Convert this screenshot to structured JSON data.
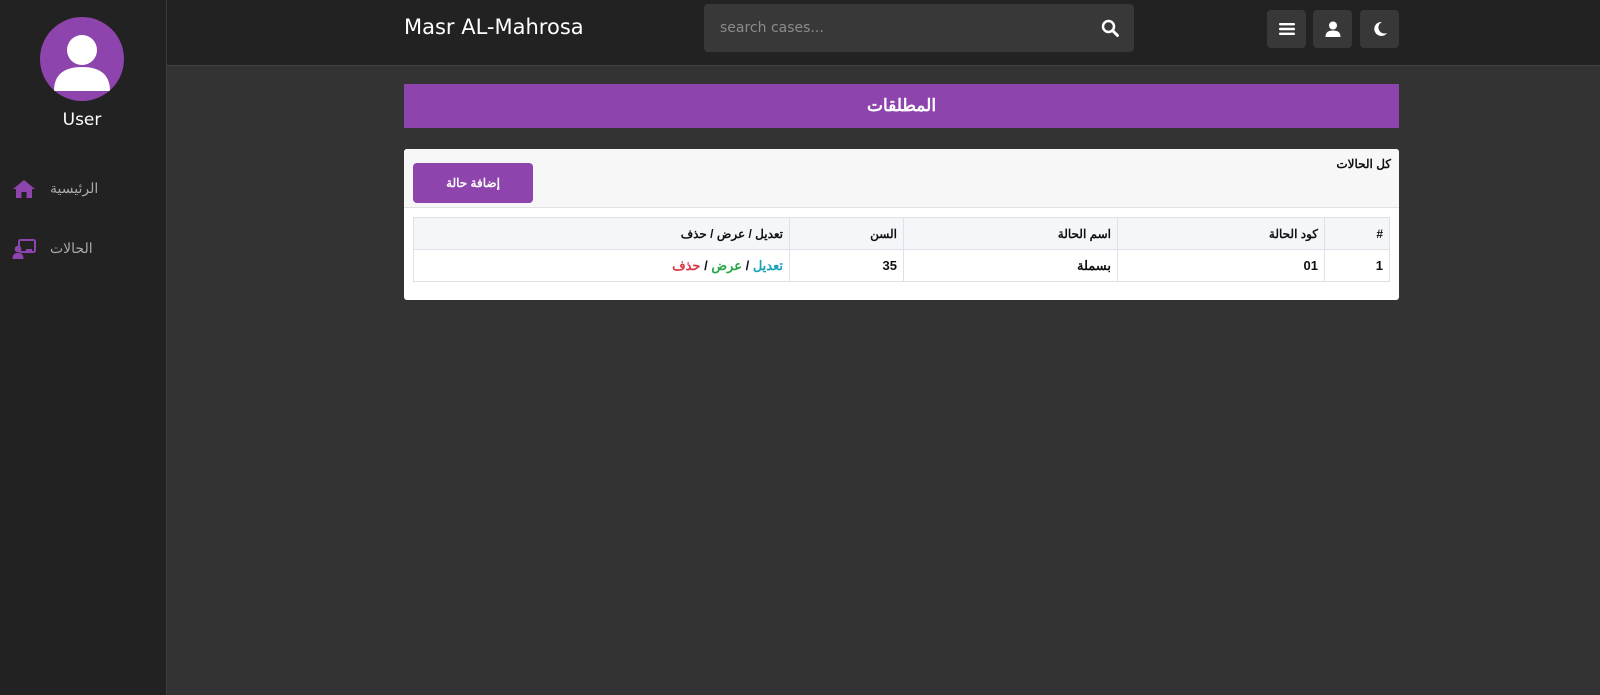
{
  "sidebar": {
    "user_name": "User",
    "items": [
      {
        "label": "الرئيسية",
        "icon": "home-icon"
      },
      {
        "label": "الحالات",
        "icon": "chalkboard-user-icon"
      }
    ]
  },
  "header": {
    "brand": "Masr AL-Mahrosa",
    "search_placeholder": "search cases...",
    "buttons": [
      "menu-icon",
      "user-icon",
      "moon-icon"
    ]
  },
  "page": {
    "title": "المطلقات"
  },
  "card": {
    "title": "كل الحالات",
    "add_button": "إضافة حالة"
  },
  "table": {
    "columns": [
      "#",
      "كود الحالة",
      "اسم الحالة",
      "السن",
      "تعديل / عرض / حذف"
    ],
    "rows": [
      {
        "num": "1",
        "code": "01",
        "name": "بسملة",
        "age": "35",
        "edit": "تعديل",
        "view": "عرض",
        "delete": "حذف"
      }
    ],
    "separator": " / "
  },
  "colors": {
    "accent": "#8e44ad",
    "background": "#333333",
    "sidebar": "#222222",
    "edit": "#17a2b8",
    "view": "#28a745",
    "delete": "#dc3545"
  }
}
